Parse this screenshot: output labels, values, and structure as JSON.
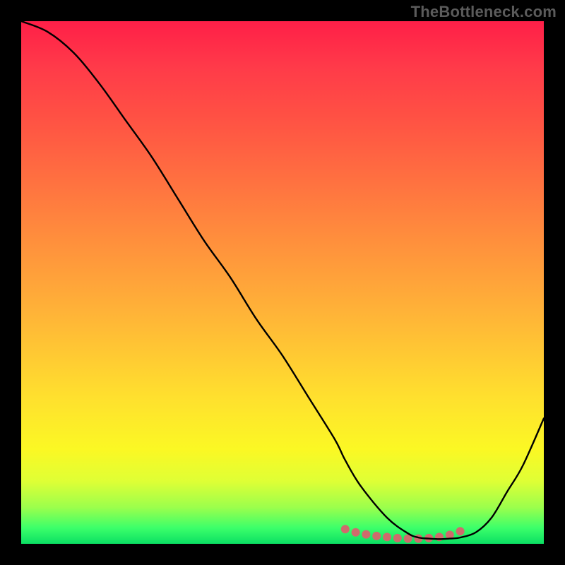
{
  "watermark": "TheBottleneck.com",
  "chart_data": {
    "type": "line",
    "title": "",
    "xlabel": "",
    "ylabel": "",
    "xlim": [
      0,
      100
    ],
    "ylim": [
      0,
      100
    ],
    "series": [
      {
        "name": "bottleneck-curve",
        "x": [
          0,
          5,
          10,
          15,
          20,
          25,
          30,
          35,
          40,
          45,
          50,
          55,
          60,
          62,
          65,
          70,
          74,
          76,
          78,
          80,
          82,
          84,
          87,
          90,
          93,
          96,
          100
        ],
        "y": [
          100,
          98,
          94,
          88,
          81,
          74,
          66,
          58,
          51,
          43,
          36,
          28,
          20,
          16,
          11,
          5,
          2,
          1.2,
          1,
          0.9,
          1,
          1.2,
          2.2,
          5,
          10,
          15,
          24
        ]
      }
    ],
    "markers": {
      "name": "valley-dots",
      "color": "#cf6b6c",
      "radius": 6,
      "x": [
        62,
        64,
        66,
        68,
        70,
        72,
        74,
        76,
        78,
        80,
        82,
        84
      ],
      "y": [
        2.8,
        2.2,
        1.8,
        1.5,
        1.3,
        1.1,
        1.0,
        1.0,
        1.1,
        1.3,
        1.7,
        2.4
      ]
    }
  }
}
